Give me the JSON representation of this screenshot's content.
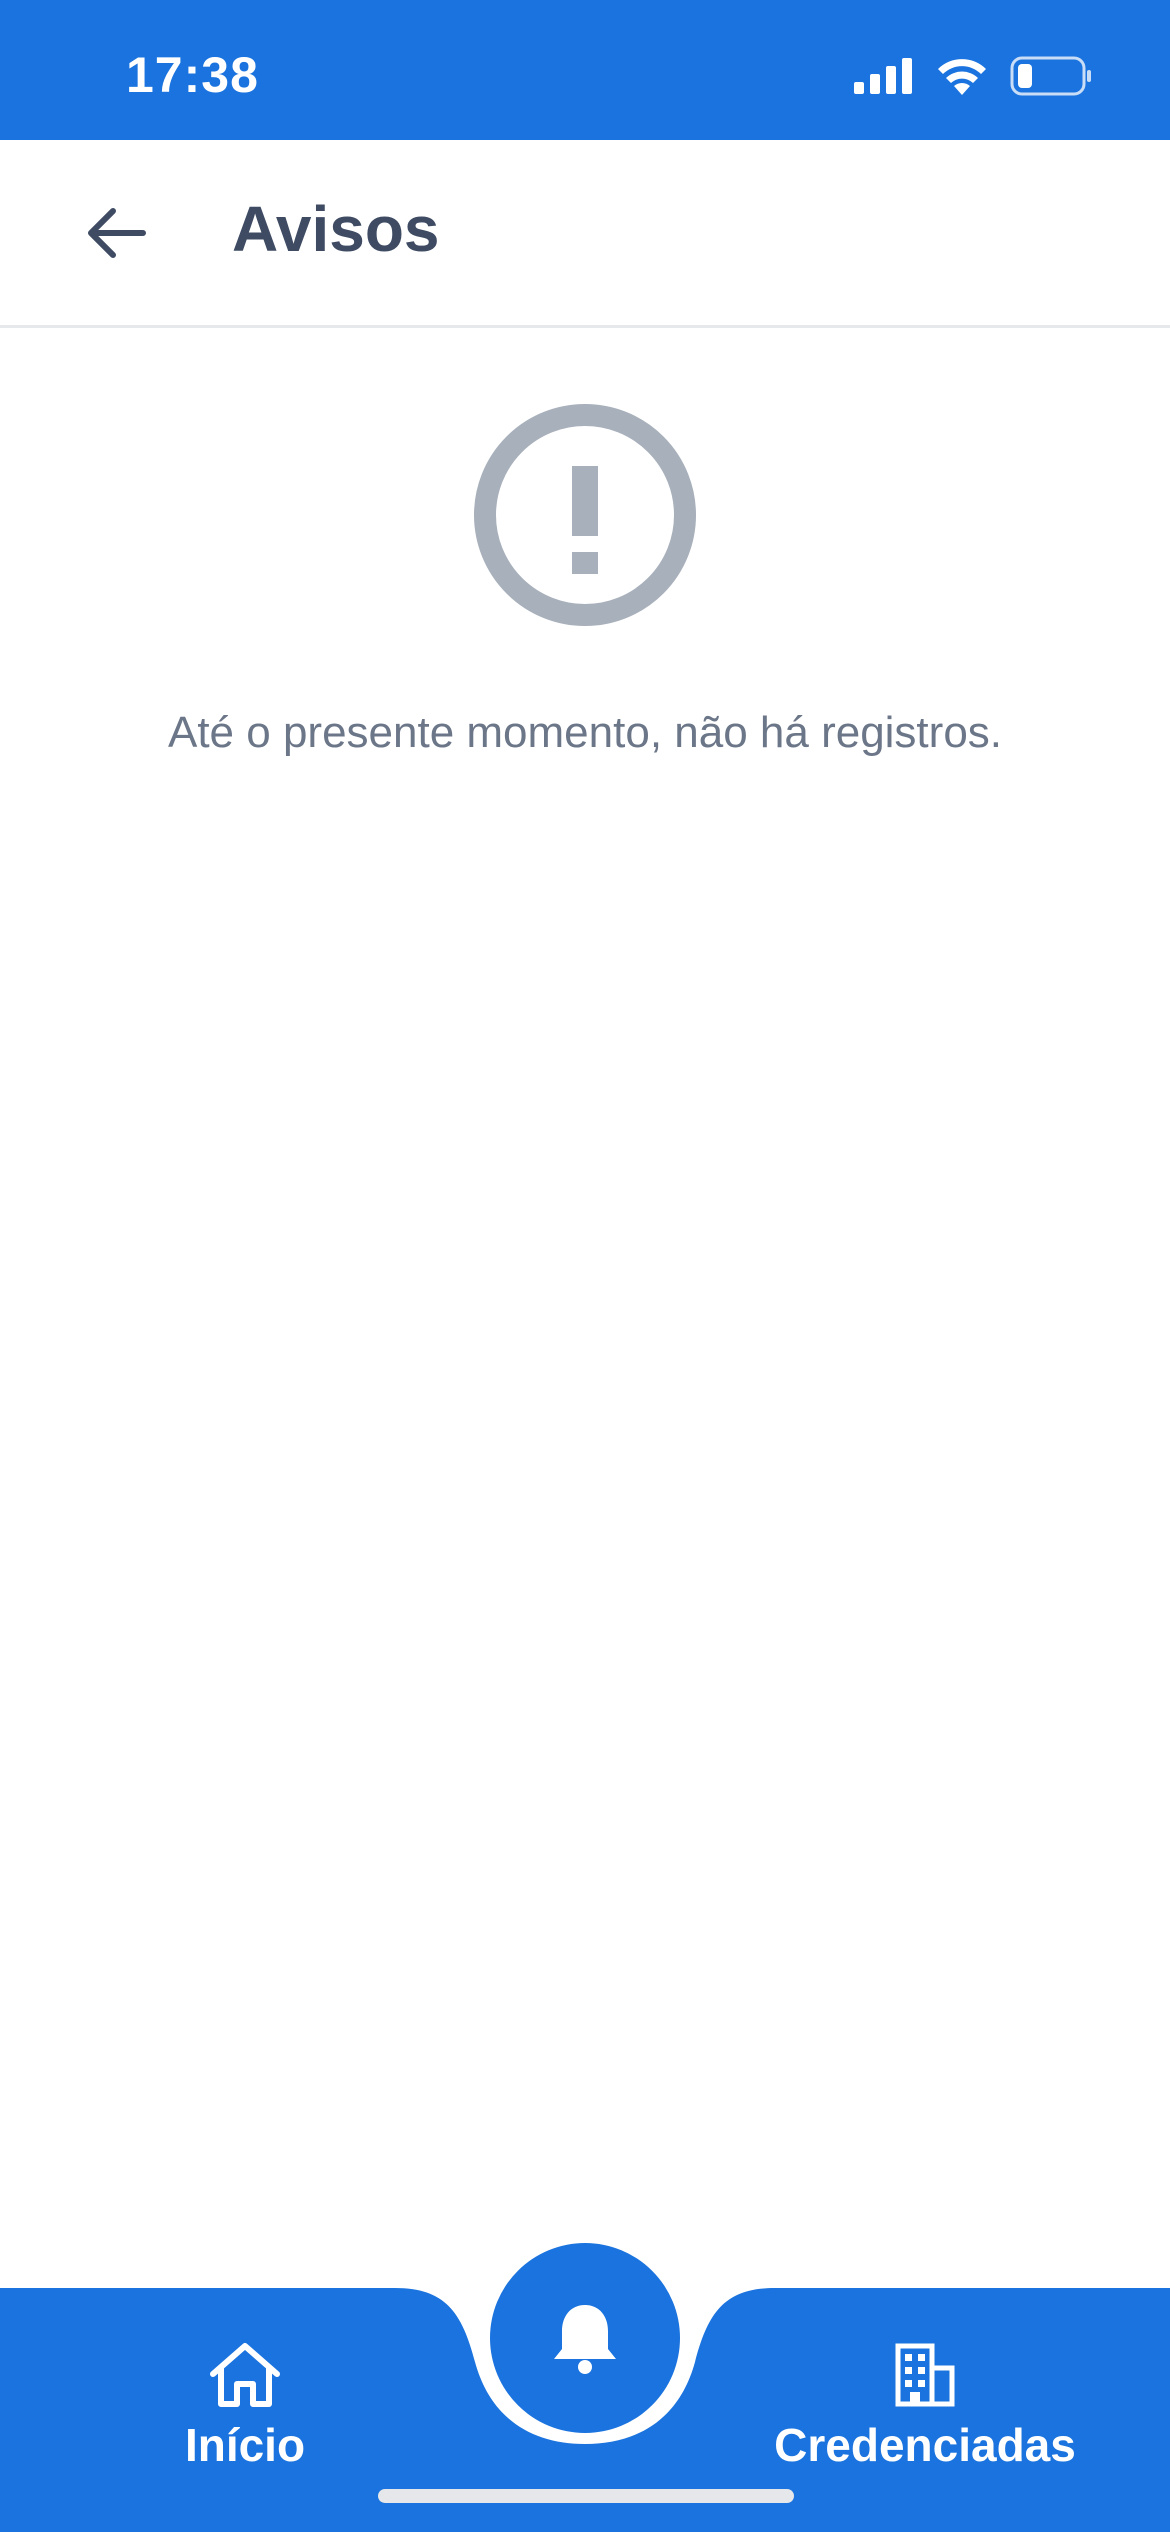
{
  "status_bar": {
    "time": "17:38",
    "icons": [
      "signal-icon",
      "wifi-icon",
      "battery-icon"
    ],
    "color": "#1a73de"
  },
  "header": {
    "title": "Avisos",
    "back_icon": "arrow-left-icon"
  },
  "empty_state": {
    "icon": "exclamation-circle-icon",
    "message": "Até o presente momento, não há registros."
  },
  "bottom_nav": {
    "items": [
      {
        "label": "Início",
        "icon": "home-icon"
      },
      {
        "label": "Credenciadas",
        "icon": "building-icon"
      }
    ],
    "center_action_icon": "bell-icon",
    "accent": "#1a73de"
  }
}
